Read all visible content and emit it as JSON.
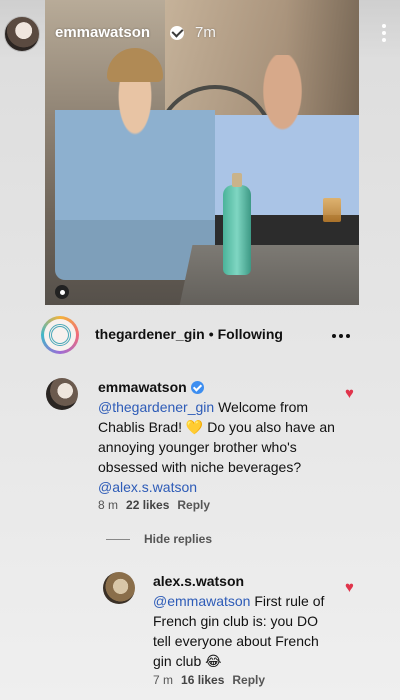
{
  "story": {
    "username": "emmawatson",
    "time": "7m"
  },
  "post": {
    "account": "thegardener_gin",
    "separator": "•",
    "follow_status": "Following"
  },
  "comments": [
    {
      "author": "emmawatson",
      "mention1": "@thegardener_gin",
      "text1": " Welcome from Chablis Brad! 💛 Do you also have an annoying younger brother who's obsessed with niche beverages? ",
      "mention2": "@alex.s.watson",
      "age": "8 m",
      "likes": "22 likes",
      "reply_label": "Reply"
    }
  ],
  "hide_replies_label": "Hide replies",
  "replies": [
    {
      "author": "alex.s.watson",
      "mention1": "@emmawatson",
      "text1": " First rule of French gin club is: you DO tell everyone about French gin club 😂",
      "age": "7 m",
      "likes": "16 likes",
      "reply_label": "Reply"
    }
  ],
  "colors": {
    "mention": "#2d5bb7",
    "heart": "#e0344b",
    "verified": "#3d8ef0"
  }
}
